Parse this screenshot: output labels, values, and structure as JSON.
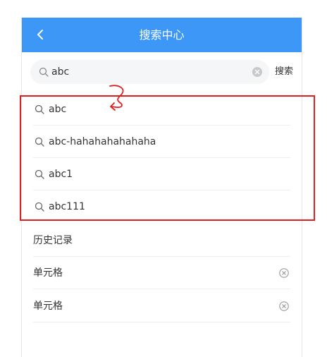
{
  "navbar": {
    "title": "搜索中心",
    "back_icon": "chevron-left-icon"
  },
  "search": {
    "value": "abc",
    "search_icon": "search-icon",
    "clear_icon": "clear-circle-icon",
    "button_label": "搜索"
  },
  "suggestions": [
    {
      "text": "abc",
      "icon": "search-icon"
    },
    {
      "text": "abc-hahahahahahaha",
      "icon": "search-icon"
    },
    {
      "text": "abc1",
      "icon": "search-icon"
    },
    {
      "text": "abc111",
      "icon": "search-icon"
    }
  ],
  "history": {
    "title": "历史记录",
    "items": [
      {
        "text": "单元格",
        "icon": "delete-circle-icon"
      },
      {
        "text": "单元格",
        "icon": "delete-circle-icon"
      }
    ]
  },
  "colors": {
    "navbar": "#3c97f7",
    "highlight": "#e02020"
  }
}
